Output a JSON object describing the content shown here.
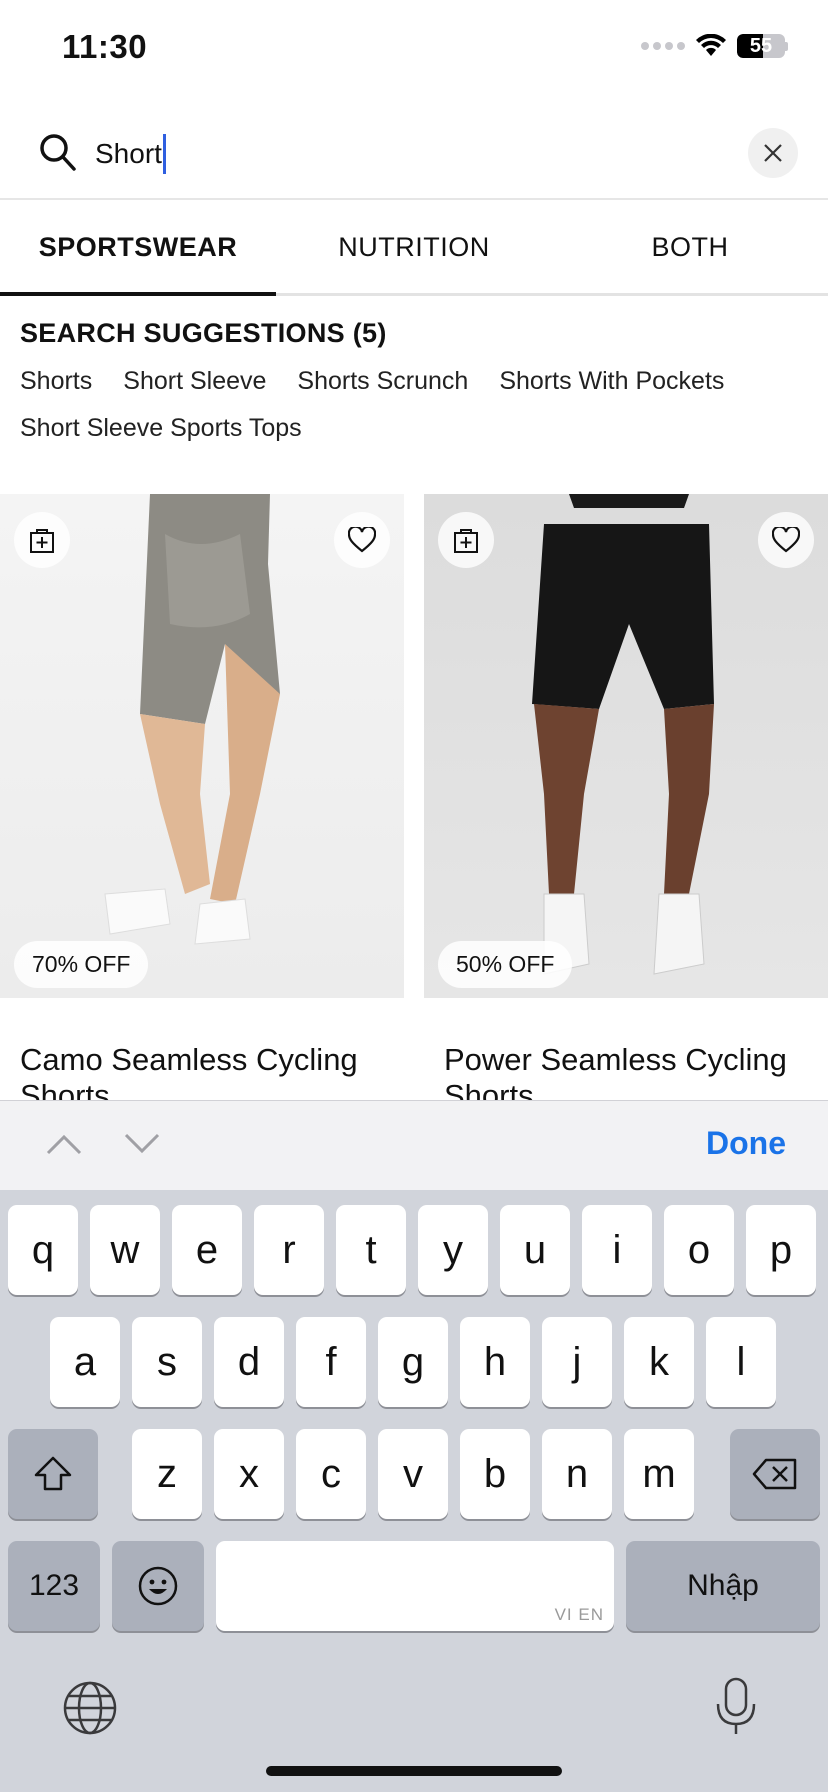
{
  "status_bar": {
    "time": "11:30",
    "battery": "55",
    "battery_level": 0.55
  },
  "search": {
    "value": "Short",
    "placeholder": ""
  },
  "tabs": [
    {
      "label": "SPORTSWEAR",
      "active": true
    },
    {
      "label": "NUTRITION",
      "active": false
    },
    {
      "label": "BOTH",
      "active": false
    }
  ],
  "suggestions": {
    "title": "SEARCH SUGGESTIONS (5)",
    "items": [
      "Shorts",
      "Short Sleeve",
      "Shorts Scrunch",
      "Shorts With Pockets",
      "Short Sleeve Sports Tops"
    ]
  },
  "products": [
    {
      "name": "Camo Seamless Cycling Shorts",
      "discount": "70% OFF"
    },
    {
      "name": "Power Seamless Cycling Shorts",
      "discount": "50% OFF"
    }
  ],
  "keyboard_toolbar": {
    "done_label": "Done"
  },
  "keyboard": {
    "row1": [
      "q",
      "w",
      "e",
      "r",
      "t",
      "y",
      "u",
      "i",
      "o",
      "p"
    ],
    "row2": [
      "a",
      "s",
      "d",
      "f",
      "g",
      "h",
      "j",
      "k",
      "l"
    ],
    "row3": [
      "z",
      "x",
      "c",
      "v",
      "b",
      "n",
      "m"
    ],
    "numbers_label": "123",
    "space_hint": "VI EN",
    "return_label": "Nhập"
  },
  "colors": {
    "accent": "#1a73e8",
    "caret": "#2f5fe0",
    "keyboard_bg": "#d1d4db"
  }
}
